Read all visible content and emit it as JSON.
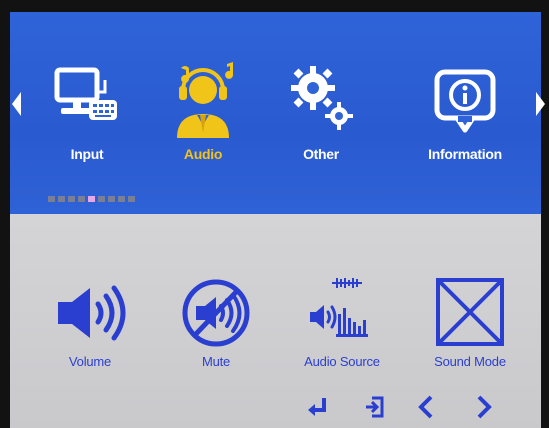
{
  "tabs": [
    {
      "label": "Input",
      "icon": "computer-keyboard-icon",
      "active": false
    },
    {
      "label": "Audio",
      "icon": "headset-person-icon",
      "active": true
    },
    {
      "label": "Other",
      "icon": "gears-icon",
      "active": false
    },
    {
      "label": "Information",
      "icon": "info-bubble-icon",
      "active": false
    }
  ],
  "page_indicator": {
    "count": 9,
    "current": 5
  },
  "items": [
    {
      "label": "Volume",
      "icon": "speaker-volume-icon"
    },
    {
      "label": "Mute",
      "icon": "speaker-mute-icon"
    },
    {
      "label": "Audio Source",
      "icon": "audio-source-icon"
    },
    {
      "label": "Sound Mode",
      "icon": "sound-mode-icon"
    }
  ],
  "footer_keys": [
    "enter-icon",
    "exit-icon",
    "chevron-left-icon",
    "chevron-right-icon"
  ],
  "colors": {
    "menu_bg": "#2f63d8",
    "content_bg": "#d0d0d3",
    "active_accent": "#f0c419",
    "item_blue": "#2a3fd0"
  }
}
